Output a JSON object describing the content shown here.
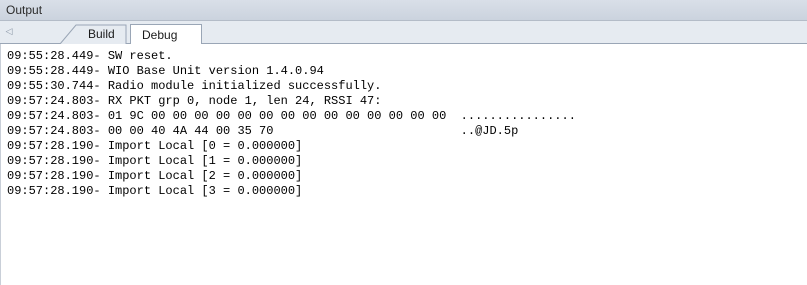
{
  "window": {
    "title": "Output"
  },
  "tabs": [
    {
      "label": "Build",
      "active": false
    },
    {
      "label": "Debug",
      "active": true
    }
  ],
  "icons": {
    "scroll_left": "scroll-left-icon"
  },
  "colors": {
    "title_bar": "#cfd6e0",
    "tab_strip": "#e6ebf1",
    "active_tab": "#ffffff",
    "text": "#000000"
  },
  "log_lines": [
    "09:55:28.449- SW reset.",
    "09:55:28.449- WIO Base Unit version 1.4.0.94",
    "09:55:30.744- Radio module initialized successfully.",
    "09:57:24.803- RX PKT grp 0, node 1, len 24, RSSI 47:",
    "09:57:24.803- 01 9C 00 00 00 00 00 00 00 00 00 00 00 00 00 00  ................",
    "09:57:24.803- 00 00 40 4A 44 00 35 70                          ..@JD.5p",
    "09:57:28.190- Import Local [0 = 0.000000]",
    "09:57:28.190- Import Local [1 = 0.000000]",
    "09:57:28.190- Import Local [2 = 0.000000]",
    "09:57:28.190- Import Local [3 = 0.000000]"
  ]
}
